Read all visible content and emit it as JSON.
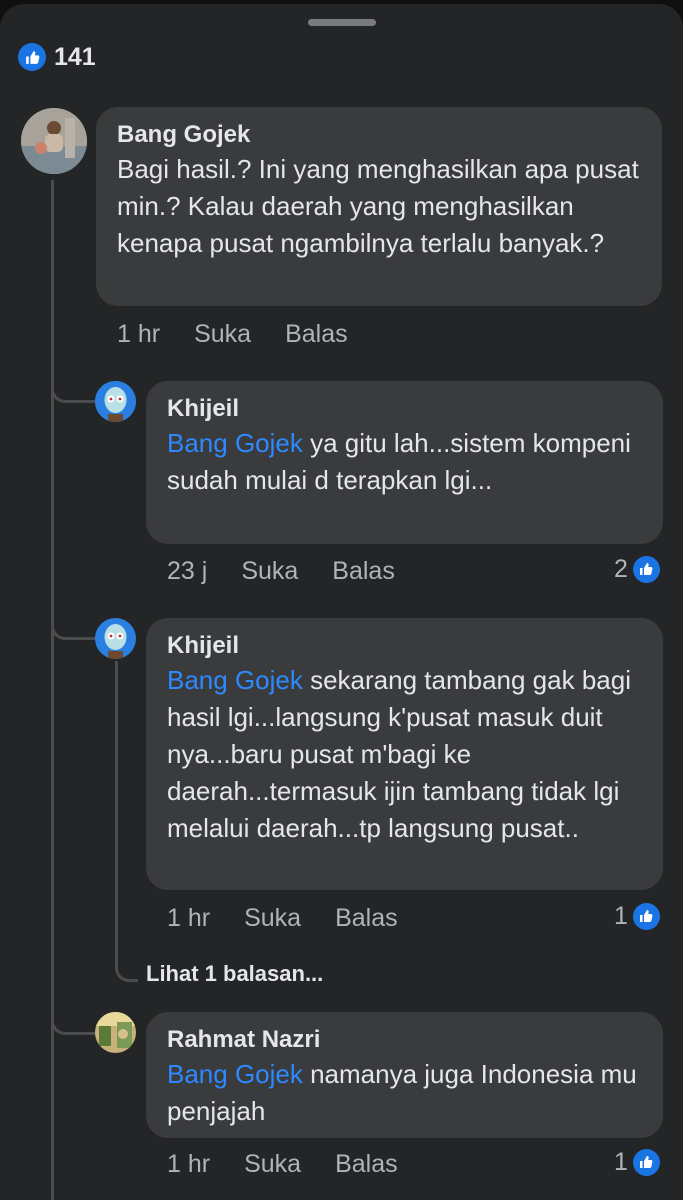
{
  "summary": {
    "like_count": "141"
  },
  "comments": [
    {
      "author": "Bang Gojek",
      "mention": "",
      "text": "Bagi hasil.? Ini yang menghasilkan apa pusat min.? Kalau daerah yang menghasilkan kenapa pusat ngambilnya terlalu banyak.?",
      "time": "1 hr",
      "like_label": "Suka",
      "reply_label": "Balas",
      "reactions": ""
    },
    {
      "author": "Khijeil",
      "mention": "Bang Gojek",
      "text": " ya gitu lah...sistem kompeni sudah mulai d terapkan lgi...",
      "time": "23 j",
      "like_label": "Suka",
      "reply_label": "Balas",
      "reactions": "2"
    },
    {
      "author": "Khijeil",
      "mention": "Bang Gojek",
      "text": " sekarang tambang gak bagi hasil lgi...langsung k'pusat masuk duit nya...baru pusat m'bagi ke daerah...termasuk ijin tambang tidak lgi melalui daerah...tp langsung pusat..",
      "time": "1 hr",
      "like_label": "Suka",
      "reply_label": "Balas",
      "reactions": "1",
      "more_replies": "Lihat 1 balasan..."
    },
    {
      "author": "Rahmat Nazri",
      "mention": "Bang Gojek",
      "text": " namanya juga Indonesia mu penjajah",
      "time": "1 hr",
      "like_label": "Suka",
      "reply_label": "Balas",
      "reactions": "1"
    }
  ],
  "colors": {
    "accent": "#1b74e4",
    "mention": "#2e89ff",
    "bubble": "#3a3b3c",
    "background": "#242526"
  }
}
